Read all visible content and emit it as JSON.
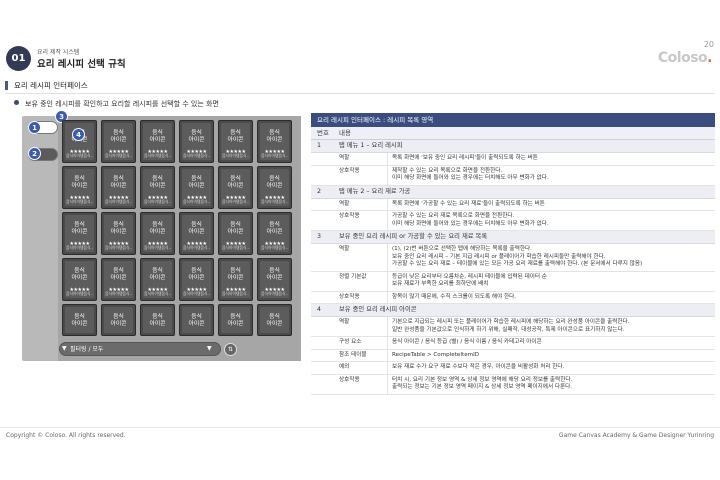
{
  "header": {
    "chapter_num": "01",
    "chapter_sub": "요리 제작 시스템",
    "chapter_title": "요리 레시피 선택 규칙",
    "page_number": "20",
    "logo": "Coloso",
    "logo_dot": "."
  },
  "section": {
    "label": "요리 레시피 인터페이스",
    "bullet": "보유 중인 레시피를 확인하고 요리할 레시피를 선택할 수 있는 화면"
  },
  "mockup": {
    "markers": [
      "1",
      "2",
      "3",
      "4"
    ],
    "cell_text_line1": "음식",
    "cell_text_line2": "아이콘",
    "cell_stars": "★★★★★",
    "cell_name": "음식아이템음식..",
    "filter_icon": "▼",
    "filter_label": "필터링 / 모두",
    "filter_arrow": "▼",
    "sort_icon": "⇅"
  },
  "table": {
    "title": "요리 레시피 인터페이스 : 레시피 목록 영역",
    "col_num": "번호",
    "col_content": "내용",
    "sections": [
      {
        "num": "1",
        "title": "탭 메뉴 1 – 요리 레시피",
        "rows": [
          {
            "label": "역할",
            "lines": [
              "목록 화면에 '보유 중인 요리 레시피'들이 출력되도록 하는 버튼"
            ]
          },
          {
            "label": "상호작용",
            "lines": [
              "제작할 수 있는 요리 목록으로 화면을 전환한다.",
              "이미 해당 화면에 들어와 있는 경우에는 터치해도 아무 변화가 없다."
            ]
          }
        ]
      },
      {
        "num": "2",
        "title": "탭 메뉴 2 – 요리 재료 가공",
        "rows": [
          {
            "label": "역할",
            "lines": [
              "목록 화면에 '가공할 수 있는 요리 재료'들이 출력되도록 하는 버튼"
            ]
          },
          {
            "label": "상호작용",
            "lines": [
              "가공할 수 있는 요리 재료 목록으로 화면을 전환한다.",
              "이미 해당 화면에 들어와 있는 경우에는 터치해도 아무 변화가 없다."
            ]
          }
        ]
      },
      {
        "num": "3",
        "title": "보유 중인 요리 레시피 or 가공할 수 있는 요리 재료 목록",
        "rows": [
          {
            "label": "역할",
            "lines": [
              "(1), (2)번 버튼으로 선택한 탭에 해당하는 목록을 출력한다.",
              "보유 중인 요리 레시피 – 기본 지급 레시피 or 플레이어가 학습한 레시피들만 출력해야 한다.",
              "가공할 수 있는 요리 재료 – 테이블에 있는 모든 가공 요리 재료를 출력해야 한다. (본 문서에서 다루지 않음)"
            ]
          },
          {
            "label": "정렬 기본값",
            "lines": [
              "등급이 낮은 요리부터 오름차순, 레시피 테이블에 입력된 데이터 순",
              "보유 재료가 부족한 요리를 최하단에 배치"
            ]
          },
          {
            "label": "상호작용",
            "lines": [
              "항목이 많기 때문에, 수직 스크롤이 되도록 해야 한다."
            ]
          }
        ]
      },
      {
        "num": "4",
        "title": "보유 중인 요리 레시피 아이콘",
        "rows": [
          {
            "label": "역할",
            "lines": [
              "기본으로 지급되는 레시피 또는 플레이어가 학습한 레시피에 해당하는 요리 완성품 아이콘을 출력한다.",
              "일반 완성품을 기본값으로 인식하게 하기 위해, 실패작, 대성공작, 특제 아이콘으로 표기하지 않는다."
            ]
          },
          {
            "label": "구성 요소",
            "lines": [
              "음식 아이콘 / 음식 등급 (별) / 음식 이름 / 음식 카테고리 아이콘"
            ]
          },
          {
            "label": "참조 테이블",
            "lines": [
              "RecipeTable > CompleteItemID"
            ]
          },
          {
            "label": "예외",
            "lines": [
              "보유 재료 수가 요구 재료 수보다 적은 경우, 아이콘을 비활성화 처리 한다."
            ]
          },
          {
            "label": "상호작용",
            "lines": [
              "터치 시, 요리 기본 정보 영역 & 상세 정보 영역에 해당 요리 정보를 출력한다.",
              "출력되는 정보는 기본 정보 영역 페이지 & 상세 정보 영역 페이지에서 다룬다."
            ]
          }
        ]
      }
    ]
  },
  "footer": {
    "copyright": "Copyright © Coloso. All rights reserved.",
    "credit": "Game Canvas Academy & Game Designer Yurinring"
  }
}
